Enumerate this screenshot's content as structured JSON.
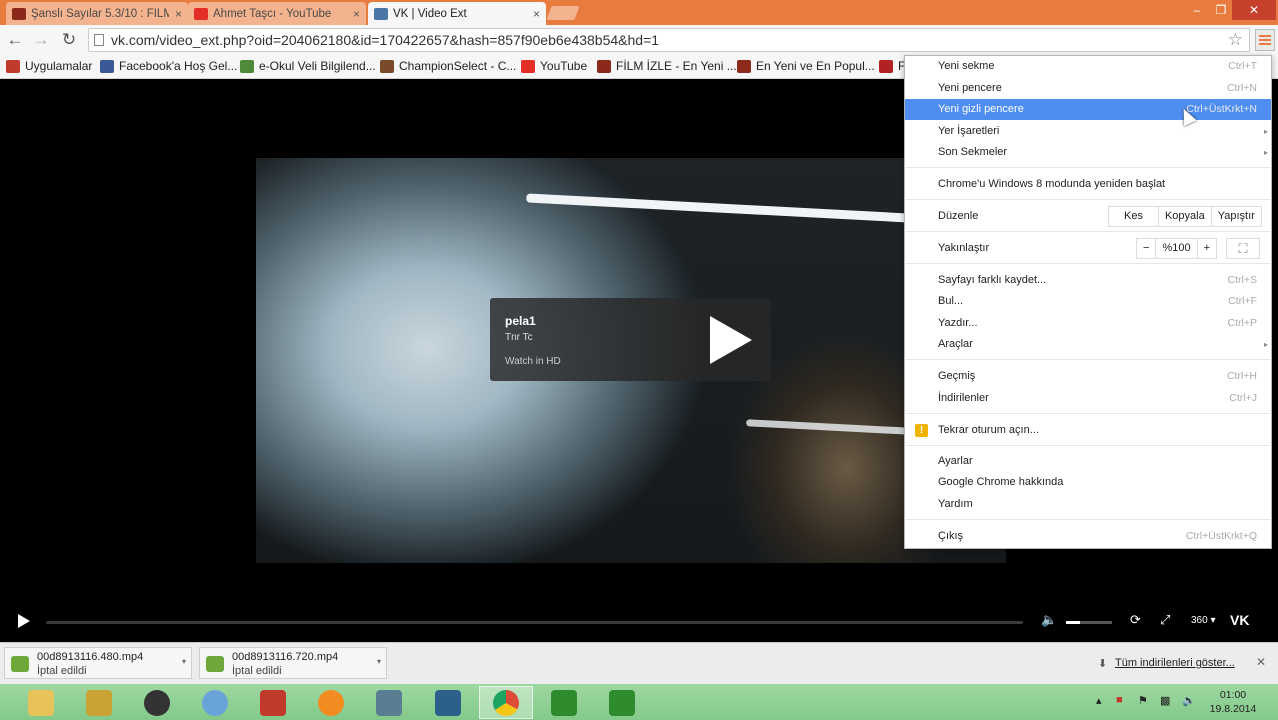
{
  "tabs": [
    {
      "title": "Şanslı Sayılar 5.3/10 : FİLM",
      "icon_color": "#8b2a1a"
    },
    {
      "title": "Ahmet Taşcı - YouTube",
      "icon_color": "#e52d27"
    },
    {
      "title": "VK | Video Ext",
      "icon_color": "#4a76a8",
      "active": true
    }
  ],
  "tab_close": "×",
  "window_controls": {
    "minimize": "‒",
    "restore": "❐",
    "close": "✕"
  },
  "toolbar": {
    "back": "←",
    "forward": "→",
    "reload": "↻",
    "url": "vk.com/video_ext.php?oid=204062180&id=170422657&hash=857f90eb6e438b54&hd=1",
    "star": "☆"
  },
  "bookmarks": [
    {
      "label": "Uygulamalar",
      "icon": "apps-icon",
      "color": "#c0392b"
    },
    {
      "label": "Facebook'a Hoş Gel...",
      "icon": "facebook-icon",
      "color": "#3b5998"
    },
    {
      "label": "e-Okul Veli Bilgilend...",
      "icon": "eokul-icon",
      "color": "#4f8a3a"
    },
    {
      "label": "ChampionSelect - C...",
      "icon": "championselect-icon",
      "color": "#7a4a2a"
    },
    {
      "label": "YouTube",
      "icon": "youtube-icon",
      "color": "#e52d27"
    },
    {
      "label": "FİLM İZLE - En Yeni ...",
      "icon": "film-icon",
      "color": "#8b2a1a"
    },
    {
      "label": "En Yeni ve En Popul...",
      "icon": "film-icon",
      "color": "#8b2a1a"
    },
    {
      "label": "F",
      "icon": "film-icon",
      "color": "#b22222"
    }
  ],
  "video": {
    "title": "pela1",
    "author": "Tnr Tc",
    "watch_hd": "Watch in HD",
    "quality": "360",
    "quality_arrow": "▾"
  },
  "menu": {
    "items": [
      {
        "label": "Yeni sekme",
        "shortcut": "Ctrl+T"
      },
      {
        "label": "Yeni pencere",
        "shortcut": "Ctrl+N"
      },
      {
        "label": "Yeni gizli pencere",
        "shortcut": "Ctrl+ÜstKrkt+N",
        "highlighted": true
      },
      {
        "label": "Yer İşaretleri",
        "shortcut": "",
        "submenu": true
      },
      {
        "label": "Son Sekmeler",
        "shortcut": "",
        "submenu": true
      },
      {
        "label": "Chrome'u Windows 8 modunda yeniden başlat",
        "shortcut": ""
      },
      {
        "label": "Düzenle",
        "shortcut": ""
      },
      {
        "label": "Yakınlaştır",
        "shortcut": ""
      },
      {
        "label": "Sayfayı farklı kaydet...",
        "shortcut": "Ctrl+S"
      },
      {
        "label": "Bul...",
        "shortcut": "Ctrl+F"
      },
      {
        "label": "Yazdır...",
        "shortcut": "Ctrl+P"
      },
      {
        "label": "Araçlar",
        "shortcut": "",
        "submenu": true
      },
      {
        "label": "Geçmiş",
        "shortcut": "Ctrl+H"
      },
      {
        "label": "İndirilenler",
        "shortcut": "Ctrl+J"
      },
      {
        "label": "Tekrar oturum açın...",
        "shortcut": ""
      },
      {
        "label": "Ayarlar",
        "shortcut": ""
      },
      {
        "label": "Google Chrome hakkında",
        "shortcut": ""
      },
      {
        "label": "Yardım",
        "shortcut": ""
      },
      {
        "label": "Çıkış",
        "shortcut": "Ctrl+ÜstKrkt+Q"
      }
    ],
    "edit": {
      "cut": "Kes",
      "copy": "Kopyala",
      "paste": "Yapıştır"
    },
    "zoom": {
      "minus": "−",
      "level": "%100",
      "plus": "+",
      "fullscreen": "⛶"
    },
    "submenu_arrow": "▸",
    "warning": "!"
  },
  "downloads": [
    {
      "name": "00d8913116.480.mp4",
      "status": "İptal edildi"
    },
    {
      "name": "00d8913116.720.mp4",
      "status": "İptal edildi"
    }
  ],
  "downloads_menu_arrow": "▾",
  "show_all_downloads": "Tüm indirilenleri göster...",
  "downloads_close": "✕",
  "taskbar": {
    "apps": [
      {
        "name": "explorer",
        "color": "#e8c35a"
      },
      {
        "name": "app-gold",
        "color": "#c9a335"
      },
      {
        "name": "speaker",
        "color": "#333333"
      },
      {
        "name": "paint",
        "color": "#6aa3d8"
      },
      {
        "name": "hourglass",
        "color": "#c0392b"
      },
      {
        "name": "orange-app",
        "color": "#f28b20"
      },
      {
        "name": "settings-app",
        "color": "#5b7d91"
      },
      {
        "name": "monitor-app",
        "color": "#2c5f8a"
      },
      {
        "name": "chrome",
        "color": "#dd4b39",
        "active": true
      },
      {
        "name": "camtasia",
        "color": "#2e8b2e"
      },
      {
        "name": "camtasia-2",
        "color": "#2e8b2e"
      }
    ],
    "time": "01:00",
    "date": "19.8.2014"
  }
}
